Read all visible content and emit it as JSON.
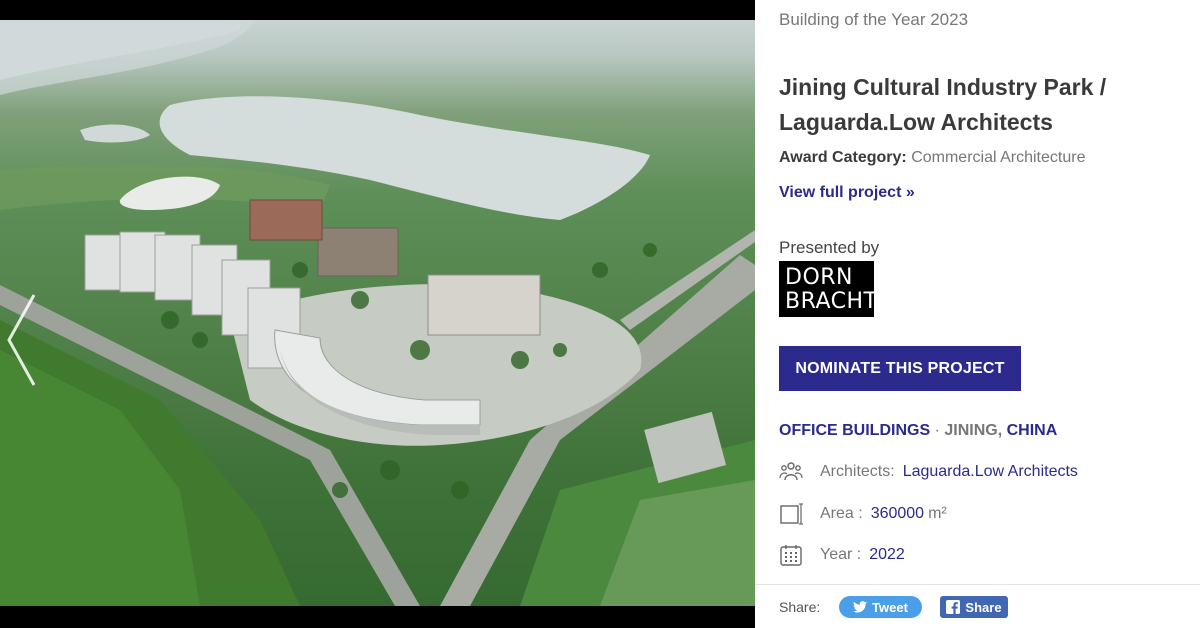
{
  "photo": {
    "alt_icon": "aerial-photo",
    "prev_icon": "chevron-left-icon"
  },
  "info": {
    "award_year": "Building of the Year 2023",
    "title": "Jining Cultural Industry Park / Laguarda.Low Architects",
    "category_label": "Award Category:",
    "category_value": "Commercial Architecture",
    "view_link": "View full project »",
    "presented_by": "Presented by",
    "sponsor_line1": "DORN",
    "sponsor_line2": "BRACHT",
    "nominate_button": "NOMINATE THIS PROJECT",
    "tag_type": "OFFICE BUILDINGS",
    "tag_sep": "·",
    "tag_city": "JINING",
    "tag_comma": ",",
    "tag_country": "CHINA",
    "architects_label": "Architects:",
    "architects_value": "Laguarda.Low Architects",
    "area_label": "Area :",
    "area_value": "360000",
    "area_unit": "m²",
    "year_label": "Year :",
    "year_value": "2022",
    "share_label": "Share:",
    "tweet_button": "Tweet",
    "share_button": "Share"
  },
  "colors": {
    "brand": "#2c2a8c",
    "twitter": "#4a9fe8",
    "facebook": "#4267b2",
    "muted": "#777777"
  },
  "icons": [
    "people-icon",
    "area-icon",
    "calendar-icon",
    "twitter-bird-icon",
    "facebook-icon"
  ]
}
